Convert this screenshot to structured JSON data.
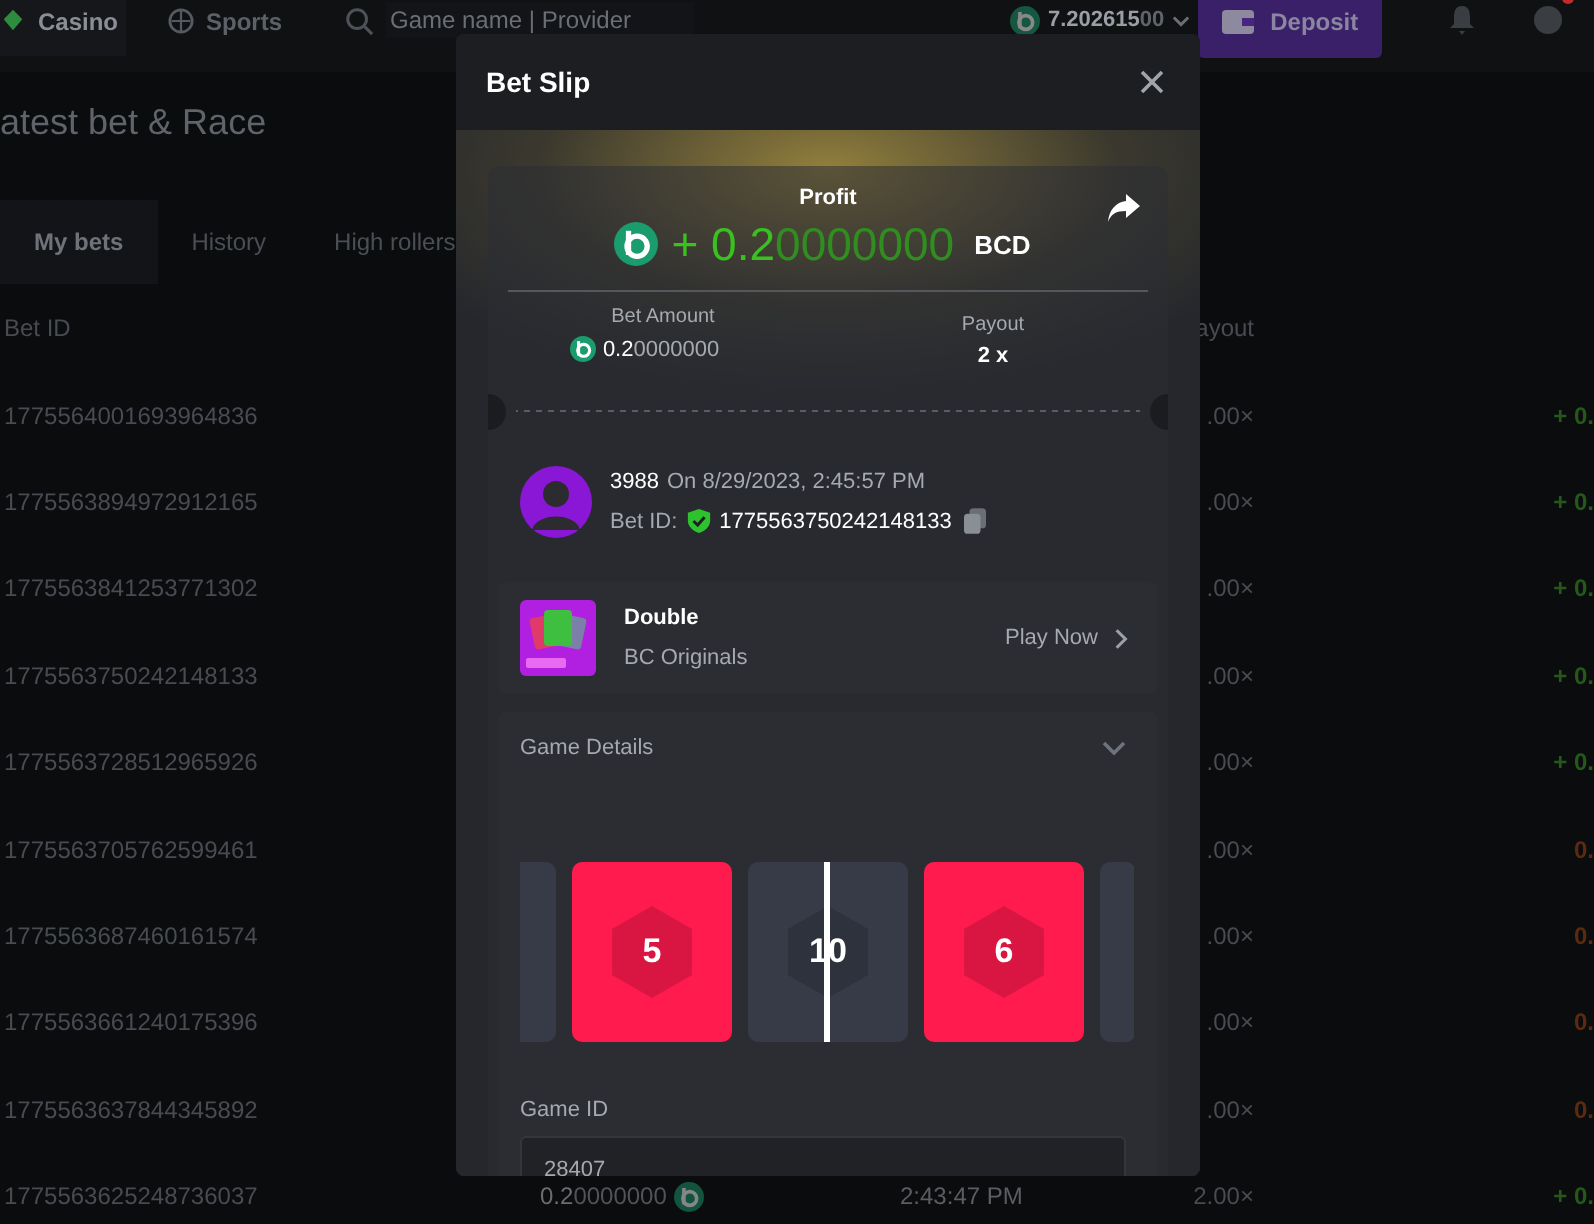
{
  "topbar": {
    "tabs": [
      {
        "label": "Casino",
        "selected": true
      },
      {
        "label": "Sports",
        "selected": false
      }
    ],
    "search": {
      "placeholder": "Game name | Provider"
    },
    "balance": {
      "main": "7.202615",
      "rest": "00"
    },
    "deposit_button": "Deposit",
    "chat": {
      "unread": true
    }
  },
  "page": {
    "title": "atest bet & Race",
    "tabs": [
      {
        "label": "My bets",
        "selected": true
      },
      {
        "label": "History",
        "selected": false
      },
      {
        "label": "High rollers",
        "selected": false
      }
    ],
    "table": {
      "columns": [
        {
          "label": "Bet ID",
          "kind": "id"
        },
        {
          "label": "ayout",
          "kind": "payout"
        }
      ],
      "rows": [
        {
          "bet_id": "1775564001693964836",
          "payout": ".00×",
          "profit": {
            "text": "+ 0.",
            "kind": "win"
          }
        },
        {
          "bet_id": "1775563894972912165",
          "payout": ".00×",
          "profit": {
            "text": "+ 0.",
            "kind": "win"
          }
        },
        {
          "bet_id": "1775563841253771302",
          "payout": ".00×",
          "profit": {
            "text": "+ 0.",
            "kind": "win"
          }
        },
        {
          "bet_id": "1775563750242148133",
          "payout": ".00×",
          "profit": {
            "text": "+ 0.",
            "kind": "win"
          }
        },
        {
          "bet_id": "1775563728512965926",
          "payout": ".00×",
          "profit": {
            "text": "+ 0.",
            "kind": "win"
          }
        },
        {
          "bet_id": "1775563705762599461",
          "payout": ".00×",
          "profit": {
            "text": "0.",
            "kind": "loss"
          }
        },
        {
          "bet_id": "1775563687460161574",
          "payout": ".00×",
          "profit": {
            "text": "0.",
            "kind": "loss"
          }
        },
        {
          "bet_id": "1775563661240175396",
          "payout": ".00×",
          "profit": {
            "text": "0.",
            "kind": "loss"
          }
        },
        {
          "bet_id": "1775563637844345892",
          "payout": ".00×",
          "profit": {
            "text": "0.",
            "kind": "loss"
          }
        },
        {
          "bet_id": "1775563625248736037",
          "amount": {
            "main": "0.2",
            "rest": "0000000"
          },
          "time": "2:43:47 PM",
          "payout": "2.00×",
          "profit": {
            "text": "+ 0.",
            "kind": "win"
          }
        }
      ]
    }
  },
  "bet_slip": {
    "title": "Bet Slip",
    "profit": {
      "label": "Profit",
      "main": "+ 0.2",
      "rest": "0000000",
      "currency": "BCD"
    },
    "bet_amount": {
      "label": "Bet Amount",
      "main": "0.2",
      "rest": "0000000"
    },
    "payout": {
      "label": "Payout",
      "value": "2 x"
    },
    "player": {
      "name": "3988",
      "time": "On 8/29/2023, 2:45:57 PM",
      "bet_id_label": "Bet ID:",
      "bet_id": "1775563750242148133",
      "verified": true
    },
    "game": {
      "name": "Double",
      "provider": "BC Originals",
      "action": "Play Now"
    },
    "details": {
      "title": "Game Details",
      "expanded": true,
      "tiles": [
        {
          "color": "#373b47"
        },
        {
          "number": "5",
          "color": "#ff1b4e"
        },
        {
          "number": "10",
          "color": "#373b47"
        },
        {
          "number": "6",
          "color": "#ff1b4e"
        },
        {
          "color": "#373b47"
        }
      ],
      "game_id_label": "Game ID",
      "game_id": "28407"
    }
  }
}
